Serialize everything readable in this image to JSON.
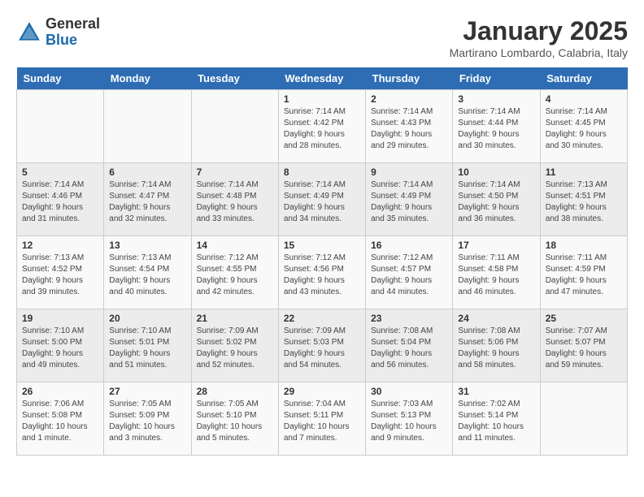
{
  "logo": {
    "general": "General",
    "blue": "Blue"
  },
  "title": "January 2025",
  "location": "Martirano Lombardo, Calabria, Italy",
  "headers": [
    "Sunday",
    "Monday",
    "Tuesday",
    "Wednesday",
    "Thursday",
    "Friday",
    "Saturday"
  ],
  "weeks": [
    [
      {
        "day": "",
        "info": ""
      },
      {
        "day": "",
        "info": ""
      },
      {
        "day": "",
        "info": ""
      },
      {
        "day": "1",
        "info": "Sunrise: 7:14 AM\nSunset: 4:42 PM\nDaylight: 9 hours and 28 minutes."
      },
      {
        "day": "2",
        "info": "Sunrise: 7:14 AM\nSunset: 4:43 PM\nDaylight: 9 hours and 29 minutes."
      },
      {
        "day": "3",
        "info": "Sunrise: 7:14 AM\nSunset: 4:44 PM\nDaylight: 9 hours and 30 minutes."
      },
      {
        "day": "4",
        "info": "Sunrise: 7:14 AM\nSunset: 4:45 PM\nDaylight: 9 hours and 30 minutes."
      }
    ],
    [
      {
        "day": "5",
        "info": "Sunrise: 7:14 AM\nSunset: 4:46 PM\nDaylight: 9 hours and 31 minutes."
      },
      {
        "day": "6",
        "info": "Sunrise: 7:14 AM\nSunset: 4:47 PM\nDaylight: 9 hours and 32 minutes."
      },
      {
        "day": "7",
        "info": "Sunrise: 7:14 AM\nSunset: 4:48 PM\nDaylight: 9 hours and 33 minutes."
      },
      {
        "day": "8",
        "info": "Sunrise: 7:14 AM\nSunset: 4:49 PM\nDaylight: 9 hours and 34 minutes."
      },
      {
        "day": "9",
        "info": "Sunrise: 7:14 AM\nSunset: 4:49 PM\nDaylight: 9 hours and 35 minutes."
      },
      {
        "day": "10",
        "info": "Sunrise: 7:14 AM\nSunset: 4:50 PM\nDaylight: 9 hours and 36 minutes."
      },
      {
        "day": "11",
        "info": "Sunrise: 7:13 AM\nSunset: 4:51 PM\nDaylight: 9 hours and 38 minutes."
      }
    ],
    [
      {
        "day": "12",
        "info": "Sunrise: 7:13 AM\nSunset: 4:52 PM\nDaylight: 9 hours and 39 minutes."
      },
      {
        "day": "13",
        "info": "Sunrise: 7:13 AM\nSunset: 4:54 PM\nDaylight: 9 hours and 40 minutes."
      },
      {
        "day": "14",
        "info": "Sunrise: 7:12 AM\nSunset: 4:55 PM\nDaylight: 9 hours and 42 minutes."
      },
      {
        "day": "15",
        "info": "Sunrise: 7:12 AM\nSunset: 4:56 PM\nDaylight: 9 hours and 43 minutes."
      },
      {
        "day": "16",
        "info": "Sunrise: 7:12 AM\nSunset: 4:57 PM\nDaylight: 9 hours and 44 minutes."
      },
      {
        "day": "17",
        "info": "Sunrise: 7:11 AM\nSunset: 4:58 PM\nDaylight: 9 hours and 46 minutes."
      },
      {
        "day": "18",
        "info": "Sunrise: 7:11 AM\nSunset: 4:59 PM\nDaylight: 9 hours and 47 minutes."
      }
    ],
    [
      {
        "day": "19",
        "info": "Sunrise: 7:10 AM\nSunset: 5:00 PM\nDaylight: 9 hours and 49 minutes."
      },
      {
        "day": "20",
        "info": "Sunrise: 7:10 AM\nSunset: 5:01 PM\nDaylight: 9 hours and 51 minutes."
      },
      {
        "day": "21",
        "info": "Sunrise: 7:09 AM\nSunset: 5:02 PM\nDaylight: 9 hours and 52 minutes."
      },
      {
        "day": "22",
        "info": "Sunrise: 7:09 AM\nSunset: 5:03 PM\nDaylight: 9 hours and 54 minutes."
      },
      {
        "day": "23",
        "info": "Sunrise: 7:08 AM\nSunset: 5:04 PM\nDaylight: 9 hours and 56 minutes."
      },
      {
        "day": "24",
        "info": "Sunrise: 7:08 AM\nSunset: 5:06 PM\nDaylight: 9 hours and 58 minutes."
      },
      {
        "day": "25",
        "info": "Sunrise: 7:07 AM\nSunset: 5:07 PM\nDaylight: 9 hours and 59 minutes."
      }
    ],
    [
      {
        "day": "26",
        "info": "Sunrise: 7:06 AM\nSunset: 5:08 PM\nDaylight: 10 hours and 1 minute."
      },
      {
        "day": "27",
        "info": "Sunrise: 7:05 AM\nSunset: 5:09 PM\nDaylight: 10 hours and 3 minutes."
      },
      {
        "day": "28",
        "info": "Sunrise: 7:05 AM\nSunset: 5:10 PM\nDaylight: 10 hours and 5 minutes."
      },
      {
        "day": "29",
        "info": "Sunrise: 7:04 AM\nSunset: 5:11 PM\nDaylight: 10 hours and 7 minutes."
      },
      {
        "day": "30",
        "info": "Sunrise: 7:03 AM\nSunset: 5:13 PM\nDaylight: 10 hours and 9 minutes."
      },
      {
        "day": "31",
        "info": "Sunrise: 7:02 AM\nSunset: 5:14 PM\nDaylight: 10 hours and 11 minutes."
      },
      {
        "day": "",
        "info": ""
      }
    ]
  ]
}
